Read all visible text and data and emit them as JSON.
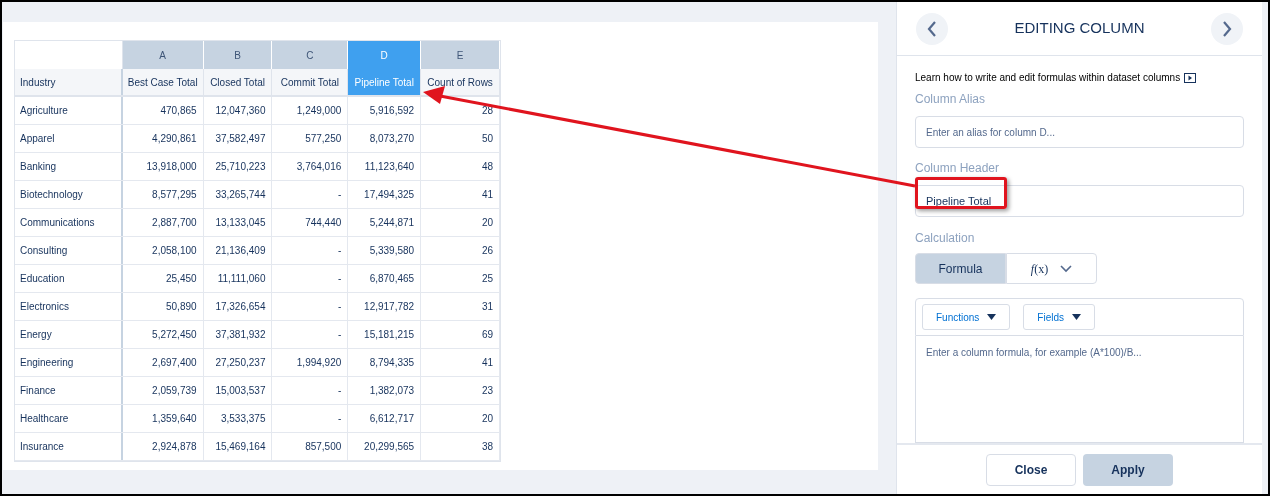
{
  "table": {
    "columns": [
      {
        "letter": "A",
        "header": "Best Case Total",
        "selected": false
      },
      {
        "letter": "B",
        "header": "Closed Total",
        "selected": false
      },
      {
        "letter": "C",
        "header": "Commit Total",
        "selected": false
      },
      {
        "letter": "D",
        "header": "Pipeline Total",
        "selected": true
      },
      {
        "letter": "E",
        "header": "Count of Rows",
        "selected": false
      }
    ],
    "row_header": "Industry",
    "rows": [
      {
        "industry": "Agriculture",
        "values": [
          "470,865",
          "12,047,360",
          "1,249,000",
          "5,916,592",
          "28"
        ]
      },
      {
        "industry": "Apparel",
        "values": [
          "4,290,861",
          "37,582,497",
          "577,250",
          "8,073,270",
          "50"
        ]
      },
      {
        "industry": "Banking",
        "values": [
          "13,918,000",
          "25,710,223",
          "3,764,016",
          "11,123,640",
          "48"
        ]
      },
      {
        "industry": "Biotechnology",
        "values": [
          "8,577,295",
          "33,265,744",
          "-",
          "17,494,325",
          "41"
        ]
      },
      {
        "industry": "Communications",
        "values": [
          "2,887,700",
          "13,133,045",
          "744,440",
          "5,244,871",
          "20"
        ]
      },
      {
        "industry": "Consulting",
        "values": [
          "2,058,100",
          "21,136,409",
          "-",
          "5,339,580",
          "26"
        ]
      },
      {
        "industry": "Education",
        "values": [
          "25,450",
          "11,111,060",
          "-",
          "6,870,465",
          "25"
        ]
      },
      {
        "industry": "Electronics",
        "values": [
          "50,890",
          "17,326,654",
          "-",
          "12,917,782",
          "31"
        ]
      },
      {
        "industry": "Energy",
        "values": [
          "5,272,450",
          "37,381,932",
          "-",
          "15,181,215",
          "69"
        ]
      },
      {
        "industry": "Engineering",
        "values": [
          "2,697,400",
          "27,250,237",
          "1,994,920",
          "8,794,335",
          "41"
        ]
      },
      {
        "industry": "Finance",
        "values": [
          "2,059,739",
          "15,003,537",
          "-",
          "1,382,073",
          "23"
        ]
      },
      {
        "industry": "Healthcare",
        "values": [
          "1,359,640",
          "3,533,375",
          "-",
          "6,612,717",
          "20"
        ]
      },
      {
        "industry": "Insurance",
        "values": [
          "2,924,878",
          "15,469,164",
          "857,500",
          "20,299,565",
          "38"
        ]
      }
    ]
  },
  "panel": {
    "title": "EDITING COLUMN",
    "learn_text": "Learn how to write and edit formulas within dataset columns",
    "alias": {
      "label": "Column Alias",
      "placeholder": "Enter an alias for column D..."
    },
    "header": {
      "label": "Column Header",
      "value": "Pipeline Total"
    },
    "calculation": {
      "label": "Calculation",
      "modes": [
        {
          "label": "Formula",
          "selected": true
        },
        {
          "label": "*f*(x)",
          "selected": false
        }
      ]
    },
    "formula": {
      "buttons": [
        "Functions",
        "Fields"
      ],
      "placeholder": "Enter a column formula, for example (A*100)/B..."
    },
    "footer": [
      {
        "label": "Close",
        "disabled": false
      },
      {
        "label": "Apply",
        "disabled": true
      }
    ]
  }
}
